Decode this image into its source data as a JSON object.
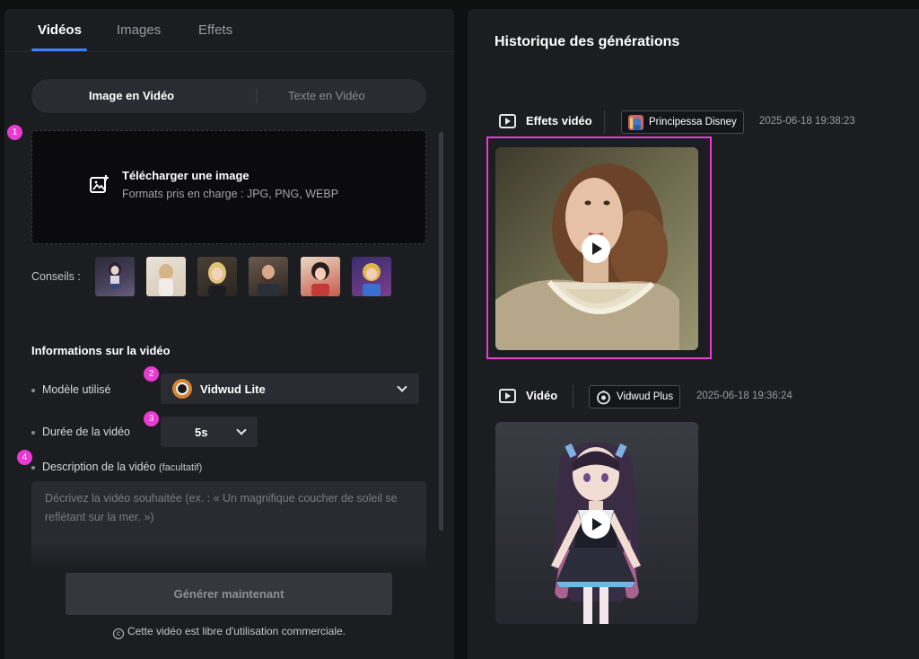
{
  "tabs": [
    {
      "label": "Vidéos",
      "active": true
    },
    {
      "label": "Images",
      "active": false
    },
    {
      "label": "Effets",
      "active": false
    }
  ],
  "mode_toggle": {
    "active": "Image en Vidéo",
    "inactive": "Texte en Vidéo"
  },
  "badges": [
    "1",
    "2",
    "3",
    "4"
  ],
  "upload": {
    "title": "Télécharger une image",
    "formats": "Formats pris en charge : JPG, PNG, WEBP",
    "icon": "image-upload-icon"
  },
  "tips": {
    "label": "Conseils :",
    "count": 6
  },
  "video_info": {
    "title": "Informations sur la vidéo",
    "model_label": "Modèle utilisé",
    "model_value": "Vidwud Lite",
    "duration_label": "Durée de la vidéo",
    "duration_value": "5s",
    "description_label": "Description de la vidéo",
    "description_optional": "(facultatif)",
    "description_placeholder": "Décrivez la vidéo souhaitée (ex. : « Un magnifique coucher de soleil se reflétant sur la mer. »)"
  },
  "generate_button": "Générer maintenant",
  "license_text": "Cette vidéo est libre d'utilisation commerciale.",
  "history": {
    "title": "Historique des générations",
    "entries": [
      {
        "type_label": "Effets vidéo",
        "type_icon": "video-effect-icon",
        "chip_label": "Principessa Disney",
        "chip_icon": "princess-thumbnail-icon",
        "timestamp": "2025-06-18 19:38:23",
        "selected": true
      },
      {
        "type_label": "Vidéo",
        "type_icon": "video-icon",
        "chip_label": "Vidwud Plus",
        "chip_icon": "vidwud-plus-icon",
        "timestamp": "2025-06-18 19:36:24",
        "selected": false
      }
    ]
  },
  "colors": {
    "accent_blue": "#3b82f6",
    "badge_pink": "#e93bd1",
    "panel": "#1c1d21",
    "background": "#0f1012"
  }
}
